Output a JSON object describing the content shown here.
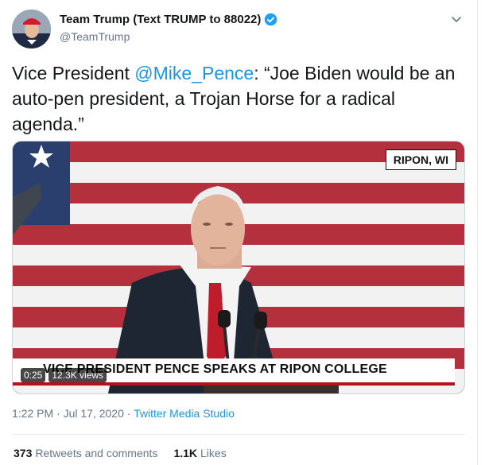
{
  "author": {
    "display_name": "Team Trump (Text TRUMP to 88022)",
    "handle": "@TeamTrump",
    "avatar_icon": "profile-avatar-icon",
    "verified_icon": "verified-badge-icon",
    "menu_icon": "chevron-down-icon"
  },
  "tweet": {
    "text_prefix": "Vice President ",
    "mention": "@Mike_Pence",
    "text_suffix": ": “Joe Biden would be an auto-pen president, a Trojan Horse for a radical agenda.”"
  },
  "media": {
    "location_tag": "RIPON, WI",
    "lower_third": "VICE PRESIDENT PENCE SPEAKS AT RIPON COLLEGE",
    "duration": "0:25",
    "views": "12.3K views"
  },
  "meta": {
    "time": "1:22 PM · Jul 17, 2020 · ",
    "source": "Twitter Media Studio"
  },
  "stats": {
    "retweets_count": "373",
    "retweets_label": "Retweets and comments",
    "likes_count": "1.1K",
    "likes_label": "Likes"
  },
  "colors": {
    "link": "#1b95e0",
    "verified": "#1da1f2",
    "flag_red": "#b5303d",
    "flag_blue": "#2a3f6e",
    "lower_third_bar": "#b3111c"
  }
}
